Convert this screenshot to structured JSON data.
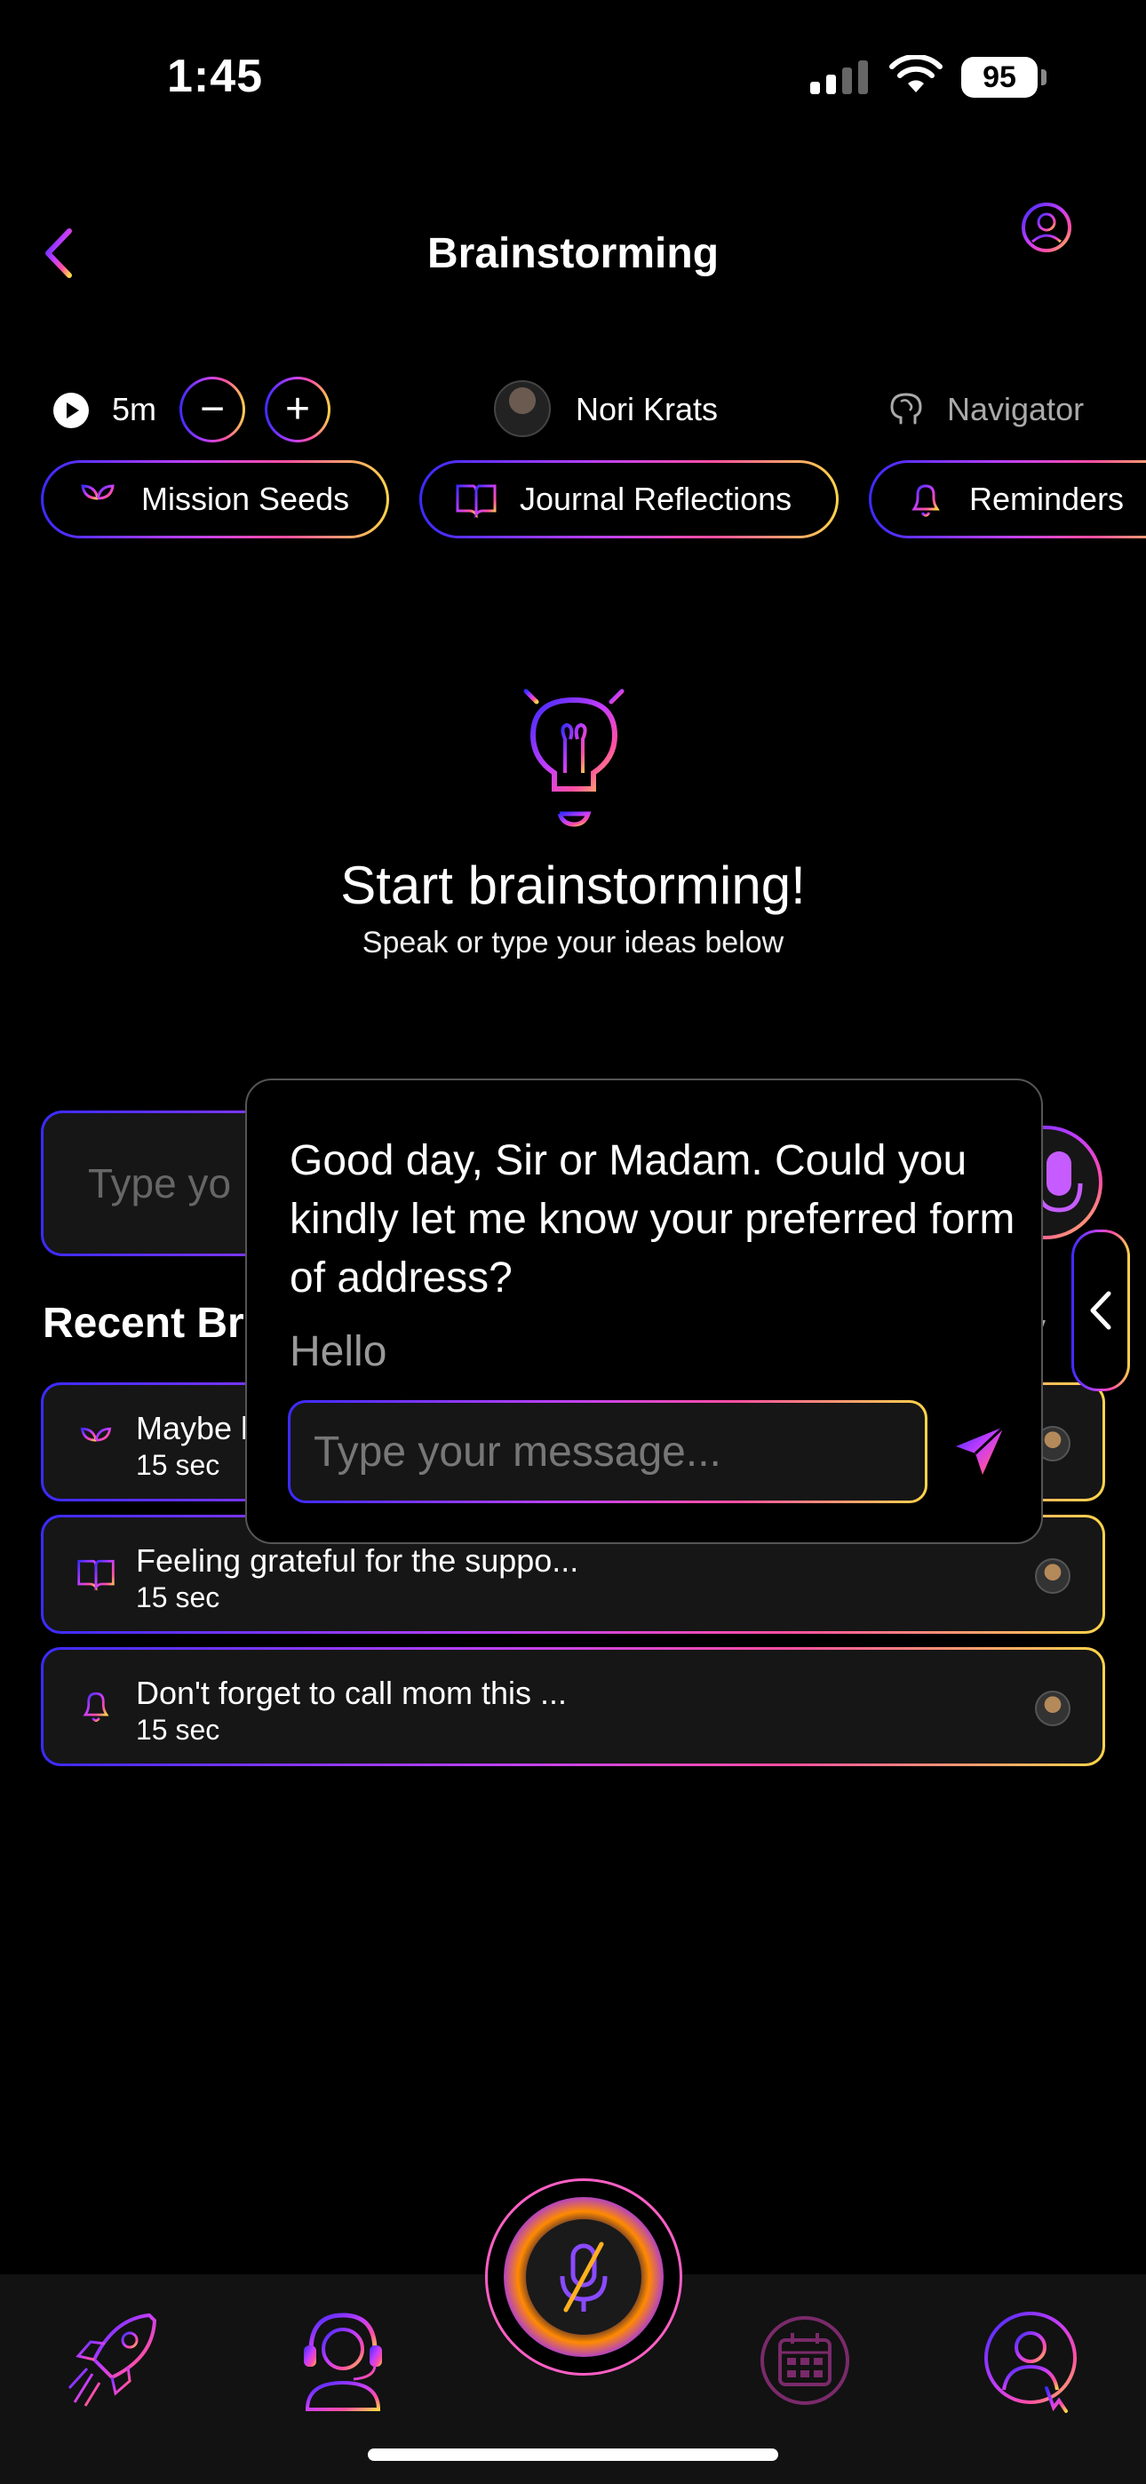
{
  "status_bar": {
    "time": "1:45",
    "battery": "95"
  },
  "header": {
    "title": "Brainstorming"
  },
  "controls": {
    "duration": "5m",
    "user_name": "Nori Krats",
    "mode": "Navigator"
  },
  "categories": [
    {
      "label": "Mission Seeds",
      "icon": "sprout-icon"
    },
    {
      "label": "Journal Reflections",
      "icon": "book-icon"
    },
    {
      "label": "Reminders",
      "icon": "bell-icon"
    }
  ],
  "hero": {
    "title": "Start brainstorming!",
    "subtitle": "Speak or type your ideas below"
  },
  "main_input": {
    "placeholder": "Type yo"
  },
  "recent": {
    "title": "Recent Br",
    "view_all": "v",
    "items": [
      {
        "text": "Maybe l",
        "duration": "15 sec",
        "icon": "sprout-icon"
      },
      {
        "text": "Feeling grateful for the suppo...",
        "duration": "15 sec",
        "icon": "book-icon"
      },
      {
        "text": "Don't forget to call mom this ...",
        "duration": "15 sec",
        "icon": "bell-icon"
      }
    ]
  },
  "popup": {
    "message": "Good day, Sir or Madam. Could you kindly let me know your preferred form of address?",
    "reply": "Hello",
    "input_placeholder": "Type your message..."
  },
  "colors": {
    "accent_blue": "#3b2bff",
    "accent_purple": "#b63fff",
    "accent_pink": "#ff4fa3",
    "accent_yellow": "#ffd54a"
  }
}
